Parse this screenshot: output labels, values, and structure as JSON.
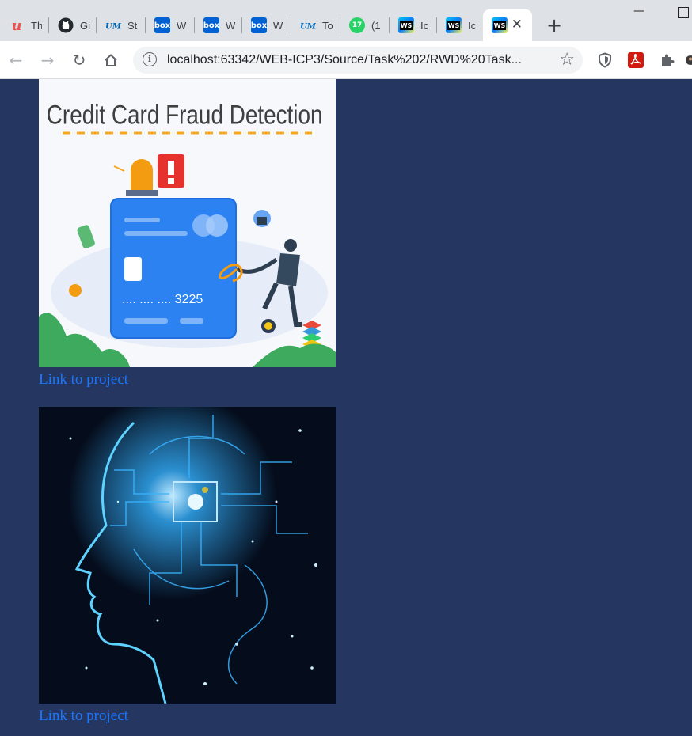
{
  "browser": {
    "tabs": [
      {
        "title": "Th",
        "icon": "udemy-icon",
        "color": "#ec5252"
      },
      {
        "title": "Gi",
        "icon": "github-icon",
        "color": "#24292e"
      },
      {
        "title": "St",
        "icon": "umkc-icon",
        "color": "#0066b3"
      },
      {
        "title": "W",
        "icon": "box-icon",
        "color": "#0061d5"
      },
      {
        "title": "W",
        "icon": "box-icon",
        "color": "#0061d5"
      },
      {
        "title": "W",
        "icon": "box-icon",
        "color": "#0061d5"
      },
      {
        "title": "To",
        "icon": "umkc-icon",
        "color": "#0066b3"
      },
      {
        "title": "(1",
        "icon": "whatsapp-icon",
        "color": "#25d366",
        "badge": "17"
      },
      {
        "title": "Ic",
        "icon": "webstorm-icon",
        "color": "#07c3f2"
      },
      {
        "title": "Ic",
        "icon": "webstorm-icon",
        "color": "#07c3f2"
      },
      {
        "title": "",
        "icon": "webstorm-icon",
        "color": "#07c3f2",
        "active": true
      }
    ],
    "new_tab": "+",
    "url": "localhost:63342/WEB-ICP3/Source/Task%202/RWD%20Task...",
    "colors": {
      "accent_link": "#1a76ff",
      "page_bg": "#253660"
    }
  },
  "projects": [
    {
      "image_title": "Credit Card Fraud Detection",
      "card_digits": ".... .... .... 3225",
      "link_text": "Link to project"
    },
    {
      "image_title": "",
      "link_text": "Link to project"
    }
  ]
}
